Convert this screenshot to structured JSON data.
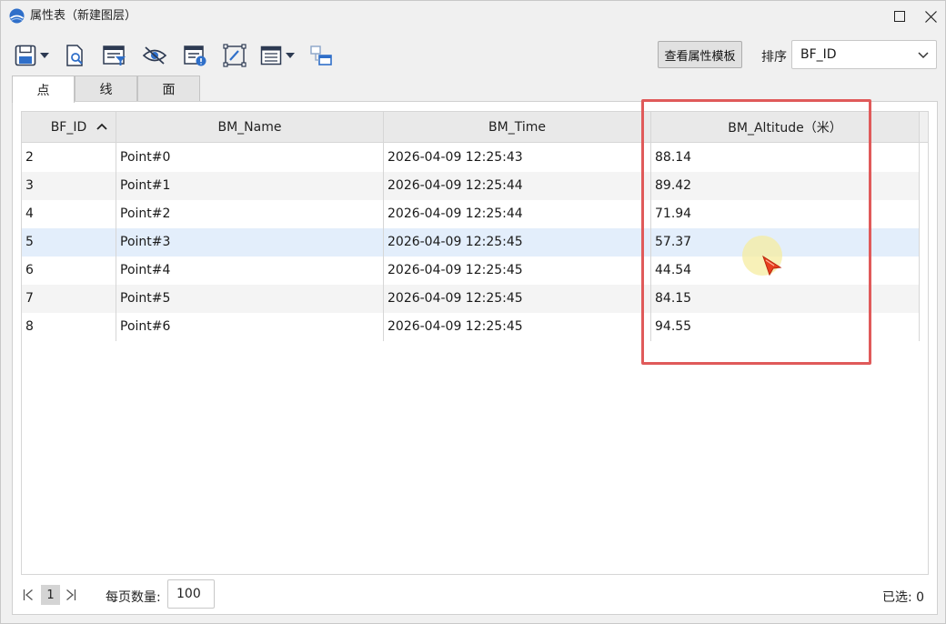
{
  "window": {
    "title": "属性表（新建图层）"
  },
  "toolbar": {
    "icons": [
      "save-icon",
      "zoom-to-icon",
      "filter-icon",
      "visibility-icon",
      "field-info-icon",
      "edit-icon",
      "table-options-icon",
      "link-windows-icon"
    ],
    "template_button": "查看属性模板",
    "sort_label": "排序",
    "sort_value": "BF_ID"
  },
  "tabs": [
    {
      "label": "点",
      "active": true
    },
    {
      "label": "线",
      "active": false
    },
    {
      "label": "面",
      "active": false
    }
  ],
  "table": {
    "columns": [
      "BF_ID",
      "BM_Name",
      "BM_Time",
      "BM_Altitude（米）"
    ],
    "sort_column": "BF_ID",
    "sort_direction": "asc",
    "rows": [
      {
        "id": "2",
        "name": "Point#0",
        "time": "2026-04-09 12:25:43",
        "altitude": "88.14"
      },
      {
        "id": "3",
        "name": "Point#1",
        "time": "2026-04-09 12:25:44",
        "altitude": "89.42"
      },
      {
        "id": "4",
        "name": "Point#2",
        "time": "2026-04-09 12:25:44",
        "altitude": "71.94"
      },
      {
        "id": "5",
        "name": "Point#3",
        "time": "2026-04-09 12:25:45",
        "altitude": "57.37"
      },
      {
        "id": "6",
        "name": "Point#4",
        "time": "2026-04-09 12:25:45",
        "altitude": "44.54"
      },
      {
        "id": "7",
        "name": "Point#5",
        "time": "2026-04-09 12:25:45",
        "altitude": "84.15"
      },
      {
        "id": "8",
        "name": "Point#6",
        "time": "2026-04-09 12:25:45",
        "altitude": "94.55"
      }
    ],
    "hovered_row": 3
  },
  "footer": {
    "current_page": "1",
    "per_page_label": "每页数量:",
    "per_page_value": "100",
    "selected_text": "已选: 0"
  },
  "colors": {
    "highlight": "#e05a5a",
    "accent": "#2f6fc9",
    "hover_row": "#e3eefb"
  }
}
